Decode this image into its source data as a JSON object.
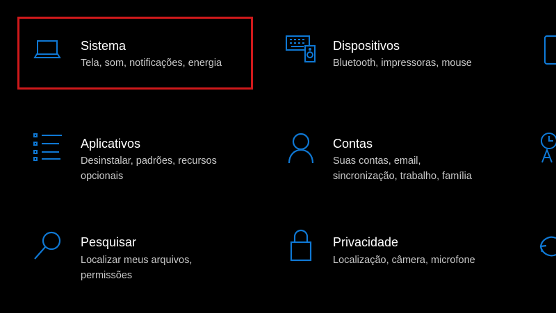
{
  "accent_color": "#0f78d4",
  "highlight_color": "#d0191b",
  "tiles": [
    {
      "icon": "laptop-icon",
      "title": "Sistema",
      "desc": [
        "Tela, som, notificações, energia"
      ]
    },
    {
      "icon": "keyboard-speaker-icon",
      "title": "Dispositivos",
      "desc": [
        "Bluetooth, impressoras, mouse"
      ]
    },
    {
      "icon": "apps-list-icon",
      "title": "Aplicativos",
      "desc": [
        "Desinstalar, padrões, recursos",
        "opcionais"
      ]
    },
    {
      "icon": "person-icon",
      "title": "Contas",
      "desc": [
        "Suas contas, email,",
        "sincronização, trabalho, família"
      ]
    },
    {
      "icon": "search-icon",
      "title": "Pesquisar",
      "desc": [
        "Localizar meus arquivos,",
        "permissões"
      ]
    },
    {
      "icon": "lock-icon",
      "title": "Privacidade",
      "desc": [
        "Localização, câmera, microfone"
      ]
    }
  ]
}
